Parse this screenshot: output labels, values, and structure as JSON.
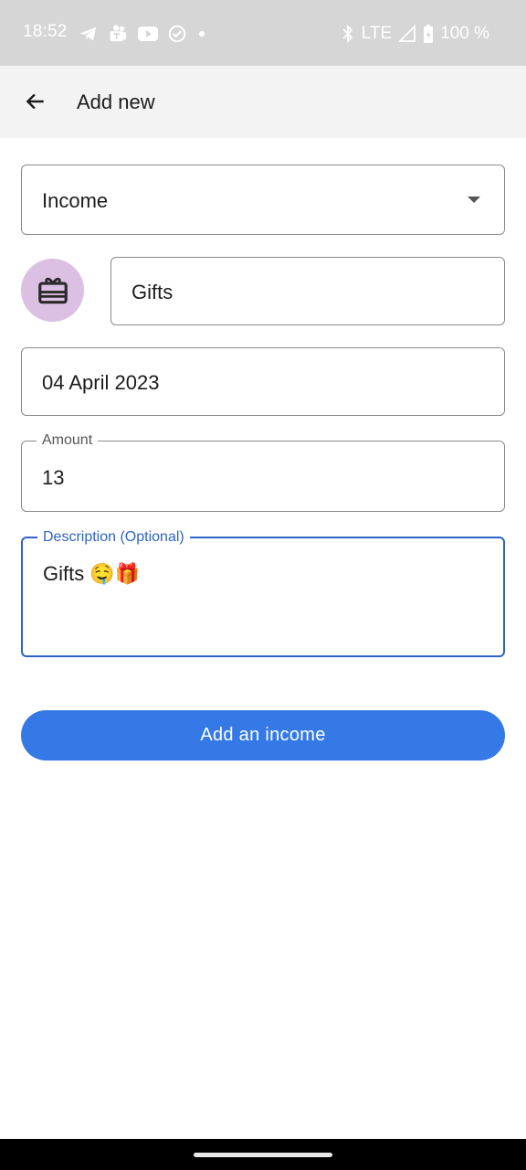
{
  "status_bar": {
    "time": "18:52",
    "network": "LTE",
    "battery": "100 %",
    "icons_left": [
      "telegram-icon",
      "teams-icon",
      "youtube-icon",
      "sync-icon",
      "dot-icon"
    ],
    "icons_right": [
      "bluetooth-icon",
      "signal-icon",
      "battery-icon"
    ]
  },
  "app_bar": {
    "title": "Add new",
    "back_icon": "arrow-back-icon"
  },
  "form": {
    "type": {
      "value": "Income",
      "icon": "dropdown-arrow-icon"
    },
    "category": {
      "value": "Gifts",
      "icon": "gift-card-icon",
      "icon_bg": "#dcc0e3"
    },
    "date": {
      "value": "04 April 2023"
    },
    "amount": {
      "label": "Amount",
      "value": "13"
    },
    "description": {
      "label": "Description (Optional)",
      "value": "Gifts 🤤🎁"
    }
  },
  "submit_button": {
    "label": "Add an income",
    "color": "#3479e6"
  },
  "colors": {
    "focus": "#2f63c7",
    "status_bar_bg": "#d6d6d6",
    "app_bar_bg": "#f3f3f3"
  }
}
